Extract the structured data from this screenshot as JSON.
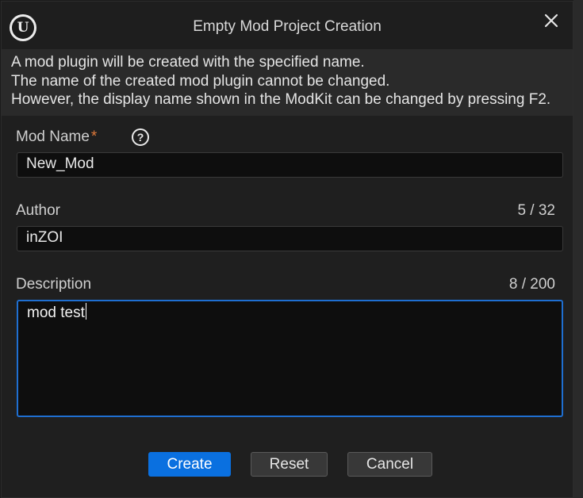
{
  "dialog": {
    "title": "Empty Mod Project Creation",
    "info_lines": [
      "A mod plugin will be created with the specified name.",
      "The name of the created mod plugin cannot be changed.",
      "However, the display name shown in the ModKit can be changed by pressing F2."
    ]
  },
  "form": {
    "mod_name": {
      "label": "Mod Name",
      "required_mark": "*",
      "help_glyph": "?",
      "value": "New_Mod"
    },
    "author": {
      "label": "Author",
      "counter": "5 / 32",
      "value": "inZOI"
    },
    "description": {
      "label": "Description",
      "counter": "8 / 200",
      "value": "mod test"
    }
  },
  "buttons": {
    "create": "Create",
    "reset": "Reset",
    "cancel": "Cancel"
  },
  "colors": {
    "accent": "#0a70e0",
    "required": "#e07a3a",
    "focus_border": "#1f6fd1"
  },
  "icons": {
    "logo": "unreal-engine-logo",
    "close": "close-icon",
    "help": "question-circle-icon"
  },
  "logo_glyph": "U"
}
